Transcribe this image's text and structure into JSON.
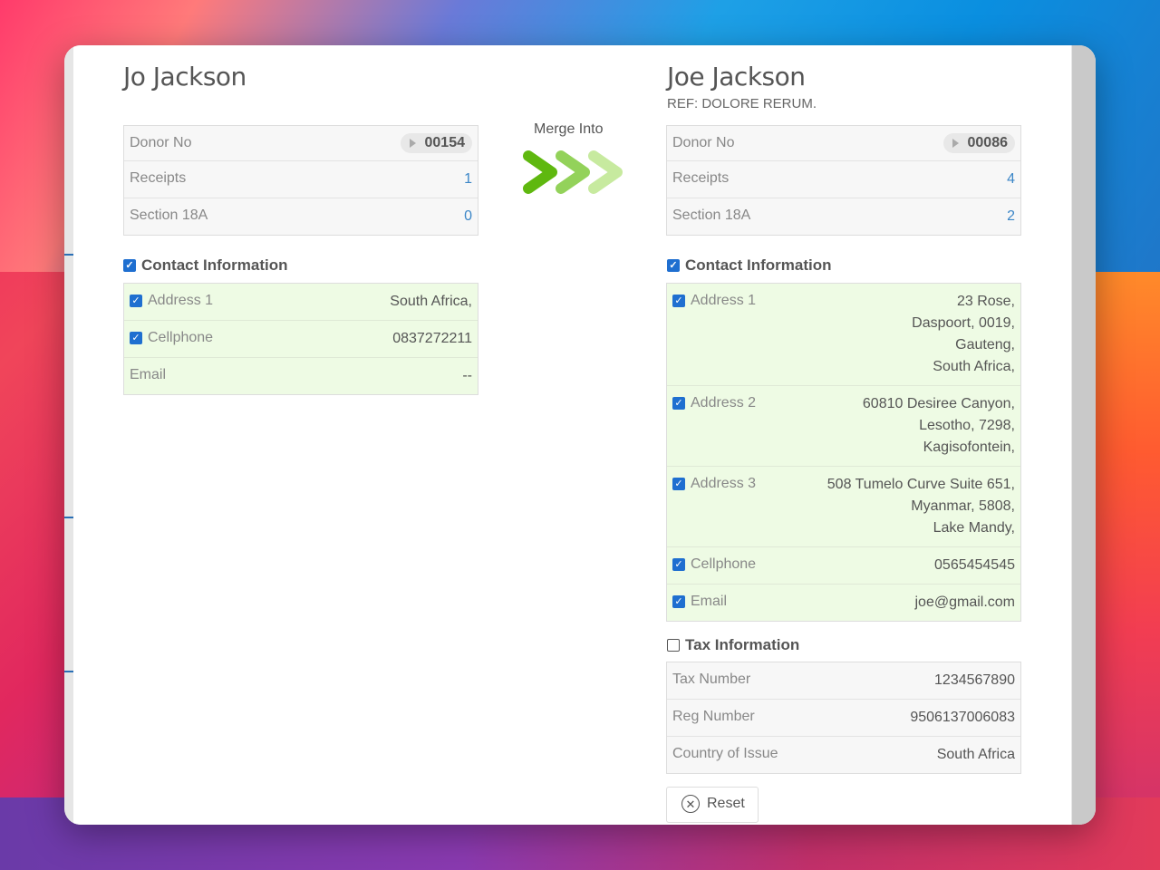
{
  "left": {
    "name": "Jo Jackson",
    "donor_no_label": "Donor No",
    "donor_no": "00154",
    "receipts_label": "Receipts",
    "receipts": "1",
    "section18a_label": "Section 18A",
    "section18a": "0",
    "contact_heading": "Contact Information",
    "contact": [
      {
        "label": "Address 1",
        "value": "South Africa,",
        "checked": true
      },
      {
        "label": "Cellphone",
        "value": "0837272211",
        "checked": true
      },
      {
        "label": "Email",
        "value": "--",
        "checked": false
      }
    ]
  },
  "merge": {
    "label": "Merge Into"
  },
  "right": {
    "name": "Joe Jackson",
    "ref": "REF: DOLORE RERUM.",
    "donor_no_label": "Donor No",
    "donor_no": "00086",
    "receipts_label": "Receipts",
    "receipts": "4",
    "section18a_label": "Section 18A",
    "section18a": "2",
    "contact_heading": "Contact Information",
    "contact": [
      {
        "label": "Address 1",
        "value_lines": [
          "23 Rose,",
          "Daspoort, 0019,",
          "Gauteng,",
          "South Africa,"
        ],
        "checked": true
      },
      {
        "label": "Address 2",
        "value_lines": [
          "60810 Desiree Canyon,",
          "Lesotho, 7298,",
          "Kagisofontein,"
        ],
        "checked": true
      },
      {
        "label": "Address 3",
        "value_lines": [
          "508 Tumelo Curve Suite 651,",
          "Myanmar, 5808,",
          "Lake Mandy,"
        ],
        "checked": true
      },
      {
        "label": "Cellphone",
        "value_lines": [
          "0565454545"
        ],
        "checked": true
      },
      {
        "label": "Email",
        "value_lines": [
          "joe@gmail.com"
        ],
        "checked": true
      }
    ],
    "tax_heading": "Tax Information",
    "tax": [
      {
        "label": "Tax Number",
        "value": "1234567890"
      },
      {
        "label": "Reg Number",
        "value": "9506137006083"
      },
      {
        "label": "Country of Issue",
        "value": "South Africa"
      }
    ]
  },
  "actions": {
    "reset_label": "Reset"
  },
  "colors": {
    "accent_green": "#6cc20a",
    "link_blue": "#3b86c7",
    "checkbox_blue": "#1f6fd0",
    "row_green": "#eefbe4"
  }
}
